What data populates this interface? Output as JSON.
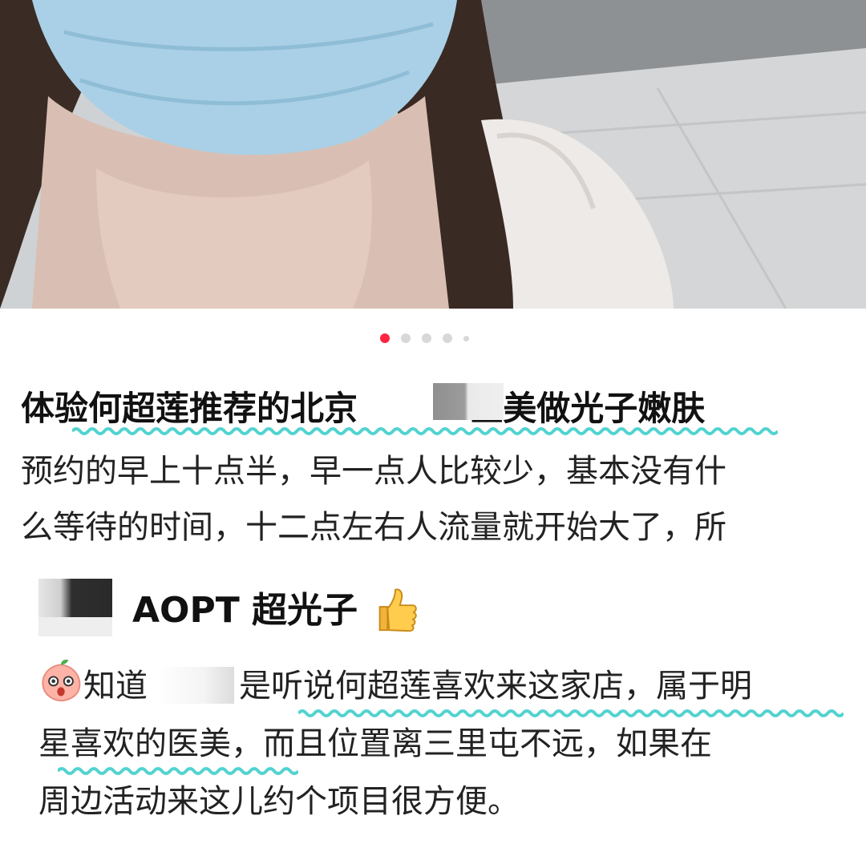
{
  "post": {
    "photo": {
      "icon": "photo-of-woman-wearing-mask"
    },
    "carousel": {
      "total": 5,
      "active_index": 1,
      "active_color": "#ff2442",
      "inactive_color": "#d8d8d8"
    },
    "title_part1": "体验何超莲推荐的北京",
    "title_part2": "医美做光子嫩肤",
    "body_line1": "预约的早上十点半，早一点人比较少，基本没有什",
    "body_line2": "么等待的时间，十二点左右人流量就开始大了，所",
    "subhead": "AOPT 超光子",
    "thumb_icon": "thumbs-up-icon",
    "peach_icon": "peach-face-icon",
    "para_part1": "知道",
    "para_part2": "是听说何超莲喜欢来这家店，属于明",
    "para_line2": "星喜欢的医美，而且位置离三里屯不远，如果在",
    "para_line3": "周边活动来这儿约个项目很方便。",
    "wave_color": "#52d3d0"
  }
}
